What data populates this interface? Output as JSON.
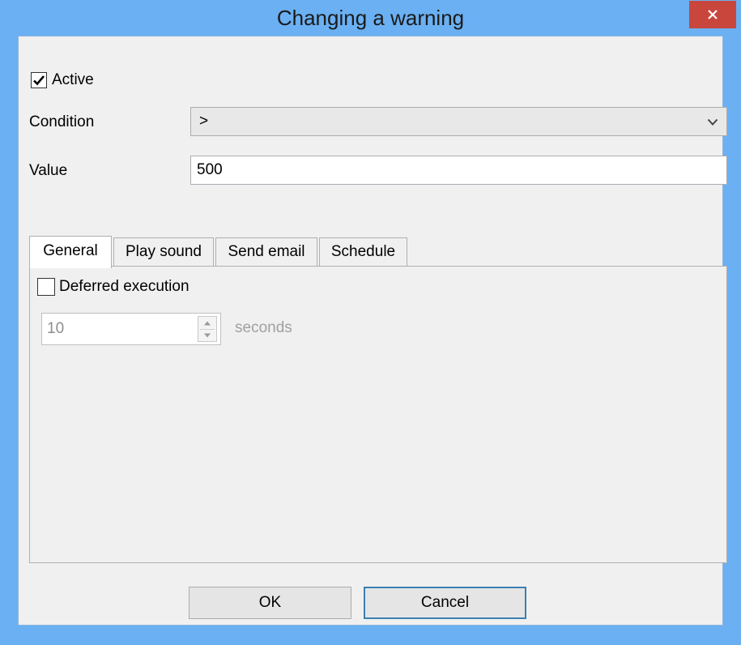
{
  "window": {
    "title": "Changing a warning",
    "close_label": "×"
  },
  "form": {
    "active": {
      "label": "Active",
      "checked": true
    },
    "condition": {
      "label": "Condition",
      "value": ">"
    },
    "value": {
      "label": "Value",
      "value": "500"
    }
  },
  "tabs": [
    {
      "label": "General",
      "active": true
    },
    {
      "label": "Play sound",
      "active": false
    },
    {
      "label": "Send email",
      "active": false
    },
    {
      "label": "Schedule",
      "active": false
    }
  ],
  "general_tab": {
    "deferred": {
      "label": "Deferred execution",
      "checked": false
    },
    "delay": {
      "value": "10",
      "unit": "seconds",
      "enabled": false
    }
  },
  "buttons": {
    "ok": "OK",
    "cancel": "Cancel"
  },
  "colors": {
    "titlebar": "#6ab0f3",
    "close_button": "#c9463d",
    "client": "#f0f0f0",
    "default_button_border": "#3c7fb1"
  }
}
